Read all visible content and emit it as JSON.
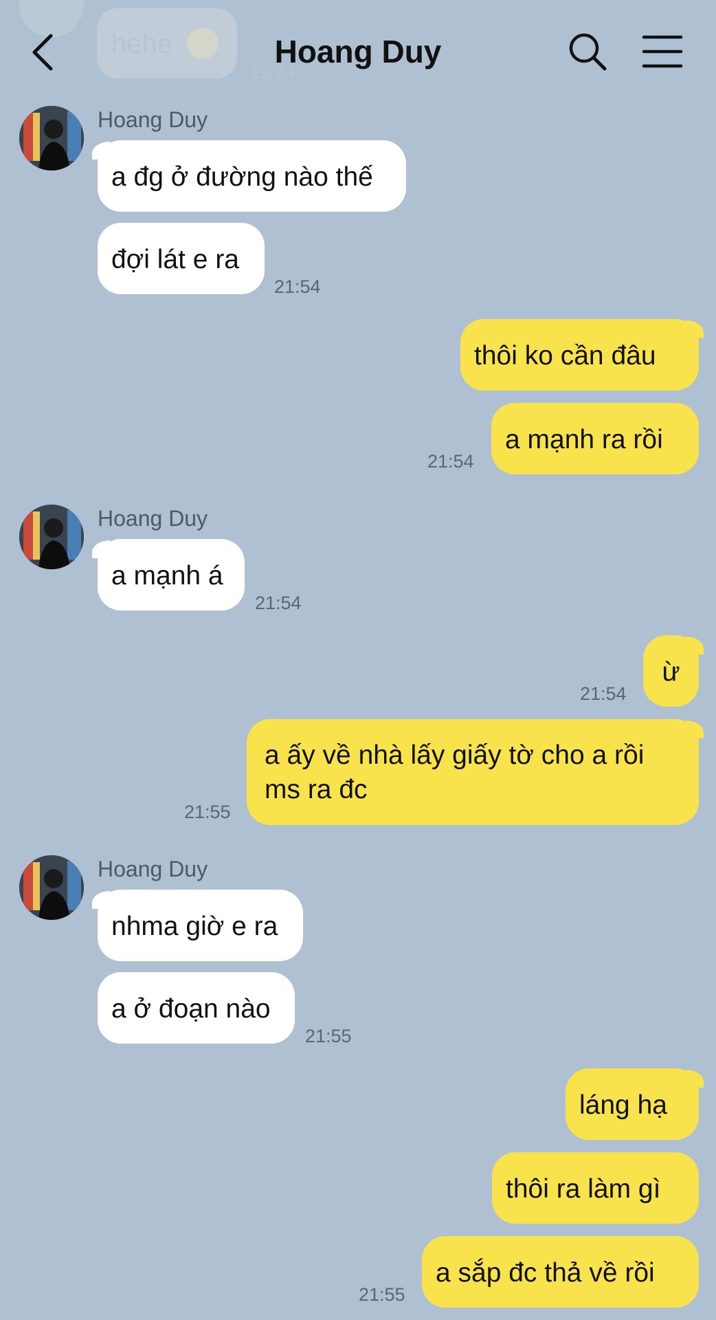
{
  "header": {
    "title": "Hoang Duy",
    "back_icon": "chevron-left-icon",
    "search_icon": "search-icon",
    "menu_icon": "hamburger-menu-icon"
  },
  "previous": {
    "text": "hehe",
    "time": "19:24"
  },
  "colors": {
    "background": "#aec0d1",
    "incoming_bubble": "#ffffff",
    "outgoing_bubble": "#f8e34c"
  },
  "messages": [
    {
      "sender": "Hoang Duy",
      "text": "a đg ở đường nào thế"
    },
    {
      "text": "đợi lát e ra",
      "time": "21:54"
    },
    {
      "text": "thôi ko cần đâu"
    },
    {
      "text": "a mạnh ra rồi",
      "time": "21:54"
    },
    {
      "sender": "Hoang Duy",
      "text": "a mạnh á",
      "time": "21:54"
    },
    {
      "text": "ừ",
      "time": "21:54"
    },
    {
      "text": "a ấy về nhà lấy giấy tờ cho a rồi ms ra đc",
      "time": "21:55"
    },
    {
      "sender": "Hoang Duy",
      "text": "nhma giờ e ra"
    },
    {
      "text": "a ở đoạn nào",
      "time": "21:55"
    },
    {
      "text": "láng hạ"
    },
    {
      "text": "thôi ra làm gì"
    },
    {
      "text": "a sắp đc thả về rồi",
      "time": "21:55"
    }
  ]
}
